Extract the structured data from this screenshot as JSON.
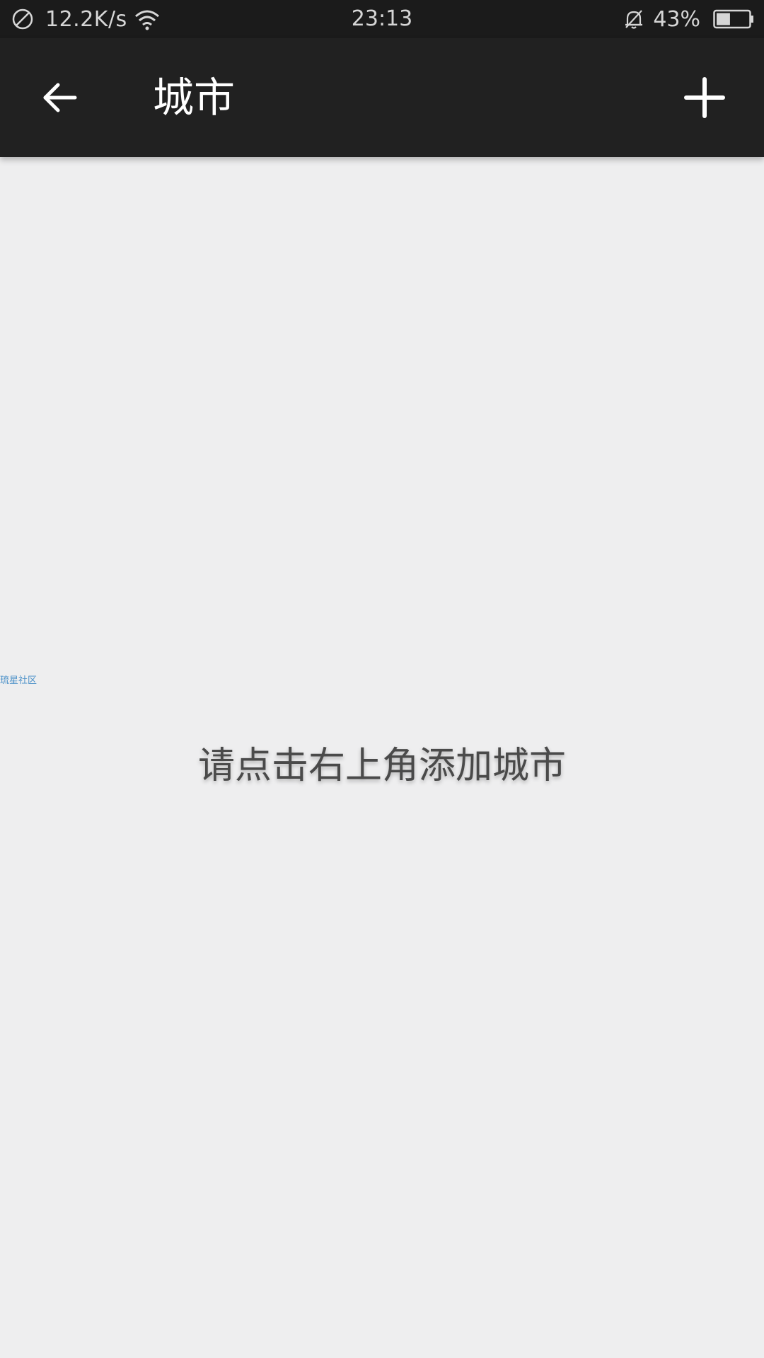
{
  "status_bar": {
    "net_speed": "12.2K/s",
    "time": "23:13",
    "battery_percent": "43%",
    "battery_level": 0.43,
    "icons": [
      "no-sim-icon",
      "wifi-icon",
      "mute-icon",
      "battery-icon"
    ]
  },
  "app_bar": {
    "title": "城市",
    "back_icon": "back-arrow-icon",
    "add_icon": "plus-icon"
  },
  "content": {
    "watermark": "琉星社区",
    "empty_hint": "请点击右上角添加城市"
  },
  "colors": {
    "status_bar_bg": "#1b1b1b",
    "app_bar_bg": "#212121",
    "page_bg": "#eeeeef",
    "hint_text": "#4a4a4a",
    "watermark_text": "#4a90c8"
  }
}
